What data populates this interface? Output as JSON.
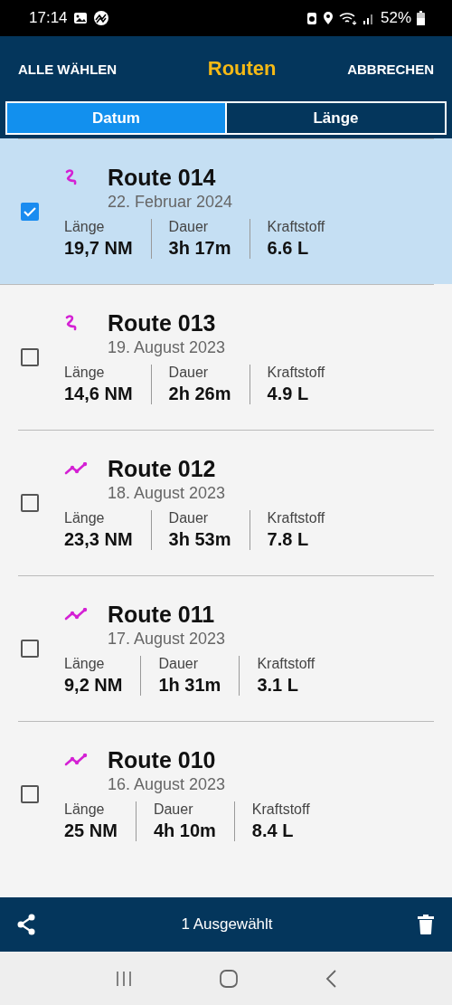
{
  "status_bar": {
    "time": "17:14",
    "battery": "52%"
  },
  "app_bar": {
    "left_action": "ALLE WÄHLEN",
    "title": "Routen",
    "right_action": "ABBRECHEN"
  },
  "tabs": [
    {
      "label": "Datum",
      "selected": true
    },
    {
      "label": "Länge",
      "selected": false
    }
  ],
  "routes": [
    {
      "name": "Route 014",
      "date": "22. Februar 2024",
      "kind": "squiggle",
      "checked": true,
      "stats": [
        {
          "label": "Länge",
          "value": "19,7 NM"
        },
        {
          "label": "Dauer",
          "value": "3h 17m"
        },
        {
          "label": "Kraftstoff",
          "value": "6.6 L"
        }
      ]
    },
    {
      "name": "Route 013",
      "date": "19. August 2023",
      "kind": "squiggle",
      "checked": false,
      "stats": [
        {
          "label": "Länge",
          "value": "14,6 NM"
        },
        {
          "label": "Dauer",
          "value": "2h 26m"
        },
        {
          "label": "Kraftstoff",
          "value": "4.9 L"
        }
      ]
    },
    {
      "name": "Route 012",
      "date": "18. August 2023",
      "kind": "zigzag",
      "checked": false,
      "stats": [
        {
          "label": "Länge",
          "value": "23,3 NM"
        },
        {
          "label": "Dauer",
          "value": "3h 53m"
        },
        {
          "label": "Kraftstoff",
          "value": "7.8 L"
        }
      ]
    },
    {
      "name": "Route 011",
      "date": "17. August 2023",
      "kind": "zigzag",
      "checked": false,
      "stats": [
        {
          "label": "Länge",
          "value": "9,2 NM"
        },
        {
          "label": "Dauer",
          "value": "1h 31m"
        },
        {
          "label": "Kraftstoff",
          "value": "3.1 L"
        }
      ]
    },
    {
      "name": "Route 010",
      "date": "16. August 2023",
      "kind": "zigzag",
      "checked": false,
      "stats": [
        {
          "label": "Länge",
          "value": "25 NM"
        },
        {
          "label": "Dauer",
          "value": "4h 10m"
        },
        {
          "label": "Kraftstoff",
          "value": "8.4 L"
        }
      ]
    }
  ],
  "bottom_bar": {
    "selection_count": "1 Ausgewählt"
  }
}
